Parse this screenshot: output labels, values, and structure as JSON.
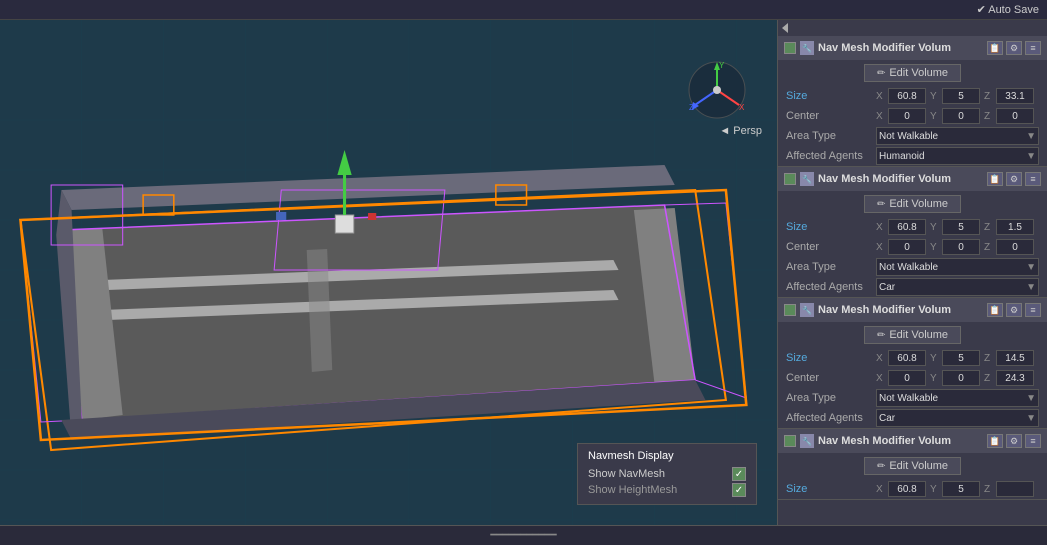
{
  "topbar": {
    "autosave_label": "✔ Auto Save"
  },
  "viewport": {
    "persp_label": "◄ Persp",
    "navmesh_popup": {
      "title": "Navmesh Display",
      "items": [
        {
          "label": "Show NavMesh",
          "checked": true
        },
        {
          "label": "Show HeightMesh",
          "checked": true
        }
      ]
    }
  },
  "inspector": {
    "components": [
      {
        "id": "comp1",
        "title": "Nav Mesh Modifier Volum",
        "edit_volume_label": "Edit Volume",
        "size_label": "Size",
        "center_label": "Center",
        "area_type_label": "Area Type",
        "affected_agents_label": "Affected Agents",
        "size": {
          "x": "60.8",
          "y": "5",
          "z": "33.1"
        },
        "center": {
          "x": "0",
          "y": "0",
          "z": "0"
        },
        "area_type": "Not Walkable",
        "affected_agents": "Humanoid"
      },
      {
        "id": "comp2",
        "title": "Nav Mesh Modifier Volum",
        "edit_volume_label": "Edit Volume",
        "size_label": "Size",
        "center_label": "Center",
        "area_type_label": "Area Type",
        "affected_agents_label": "Affected Agents",
        "size": {
          "x": "60.8",
          "y": "5",
          "z": "1.5"
        },
        "center": {
          "x": "0",
          "y": "0",
          "z": "0"
        },
        "area_type": "Not Walkable",
        "affected_agents": "Car"
      },
      {
        "id": "comp3",
        "title": "Nav Mesh Modifier Volum",
        "edit_volume_label": "Edit Volume",
        "size_label": "Size",
        "center_label": "Center",
        "area_type_label": "Area Type",
        "affected_agents_label": "Affected Agents",
        "size": {
          "x": "60.8",
          "y": "5",
          "z": "14.5"
        },
        "center": {
          "x": "0",
          "y": "0",
          "z": "24.3"
        },
        "area_type": "Not Walkable",
        "affected_agents": "Car"
      },
      {
        "id": "comp4",
        "title": "Nav Mesh Modifier Volum",
        "edit_volume_label": "Edit Volume",
        "size_label": "Size",
        "size_x": "60.8",
        "size_y": "5",
        "size_z": ""
      }
    ]
  },
  "icons": {
    "component_icon": "🔧",
    "edit_icon": "✏",
    "copy_icon": "📋",
    "settings_icon": "⚙",
    "more_icon": "≡"
  }
}
